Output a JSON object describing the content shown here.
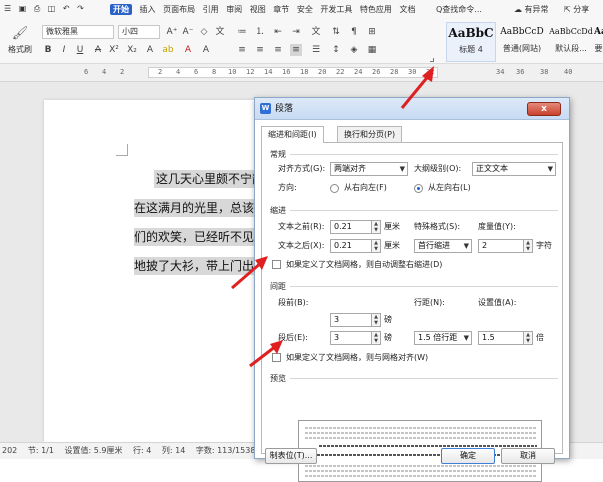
{
  "toolbar": {
    "quick_icons": [
      "menu-icon",
      "save-icon",
      "print-icon",
      "preview-icon",
      "undo-icon",
      "redo-icon"
    ],
    "menu": [
      "开始",
      "插入",
      "页面布局",
      "引用",
      "审阅",
      "视图",
      "章节",
      "安全",
      "开发工具",
      "特色应用",
      "文档"
    ],
    "search_placeholder": "Q查找命令...",
    "sync_status": "有异常",
    "share_label": "分享",
    "format_painter_label": "格式刷",
    "font_name": "微软雅黑",
    "font_size": "小四",
    "styles": [
      {
        "preview": "AaBbC",
        "name": "标题 4"
      },
      {
        "preview": "AaBbCcD",
        "name": "普通(网站)"
      },
      {
        "preview": "AaBbCcDd",
        "name": "默认段..."
      },
      {
        "preview": "AaBb",
        "name": "要"
      }
    ]
  },
  "ruler": {
    "numbers": [
      "6",
      "4",
      "2",
      "2",
      "4",
      "6",
      "8",
      "10",
      "12",
      "14",
      "16",
      "18",
      "20",
      "22",
      "24",
      "26",
      "28",
      "30",
      "32",
      "34",
      "36",
      "38",
      "40"
    ]
  },
  "document": {
    "lines": [
      "这几天心里颇不宁静",
      "在这满月的光里，总该另",
      "们的欢笑，已经听不见了",
      "地披了大衫，带上门出去"
    ]
  },
  "status_bar": {
    "page_num": "202",
    "section": "节: 1/1",
    "setting": "设置值: 5.9厘米",
    "row": "行: 4",
    "col": "列: 14",
    "words": "字数: 113/1538"
  },
  "dialog": {
    "title": "段落",
    "close_label": "x",
    "tabs": [
      "缩进和间距(I)",
      "换行和分页(P)"
    ],
    "general": {
      "heading": "常规",
      "alignment_label": "对齐方式(G):",
      "alignment_value": "两端对齐",
      "outline_label": "大纲级别(O):",
      "outline_value": "正文文本",
      "direction_label": "方向:",
      "rtl_label": "从右向左(F)",
      "ltr_label": "从左向右(L)"
    },
    "indent": {
      "heading": "缩进",
      "before_label": "文本之前(R):",
      "before_value": "0.21",
      "before_unit": "厘米",
      "after_label": "文本之后(X):",
      "after_value": "0.21",
      "after_unit": "厘米",
      "special_label": "特殊格式(S):",
      "special_value": "首行缩进",
      "measure_label": "度量值(Y):",
      "measure_value": "2",
      "measure_unit": "字符",
      "grid_checkbox_label": "如果定义了文档网格，则自动调整右缩进(D)"
    },
    "spacing": {
      "heading": "间距",
      "before_label": "段前(B):",
      "before_value": "3",
      "before_unit": "磅",
      "after_label": "段后(E):",
      "after_value": "3",
      "after_unit": "磅",
      "line_label": "行距(N):",
      "line_value": "1.5 倍行距",
      "setting_label": "设置值(A):",
      "setting_value": "1.5",
      "setting_unit": "倍",
      "grid_checkbox_label": "如果定义了文档网格，则与网格对齐(W)"
    },
    "preview": {
      "heading": "预览"
    },
    "buttons": {
      "tabs": "制表位(T)...",
      "ok": "确定",
      "cancel": "取消"
    }
  },
  "colors": {
    "accent": "#2b62c8",
    "arrow": "#e02020",
    "selection": "#d8d8d8"
  }
}
